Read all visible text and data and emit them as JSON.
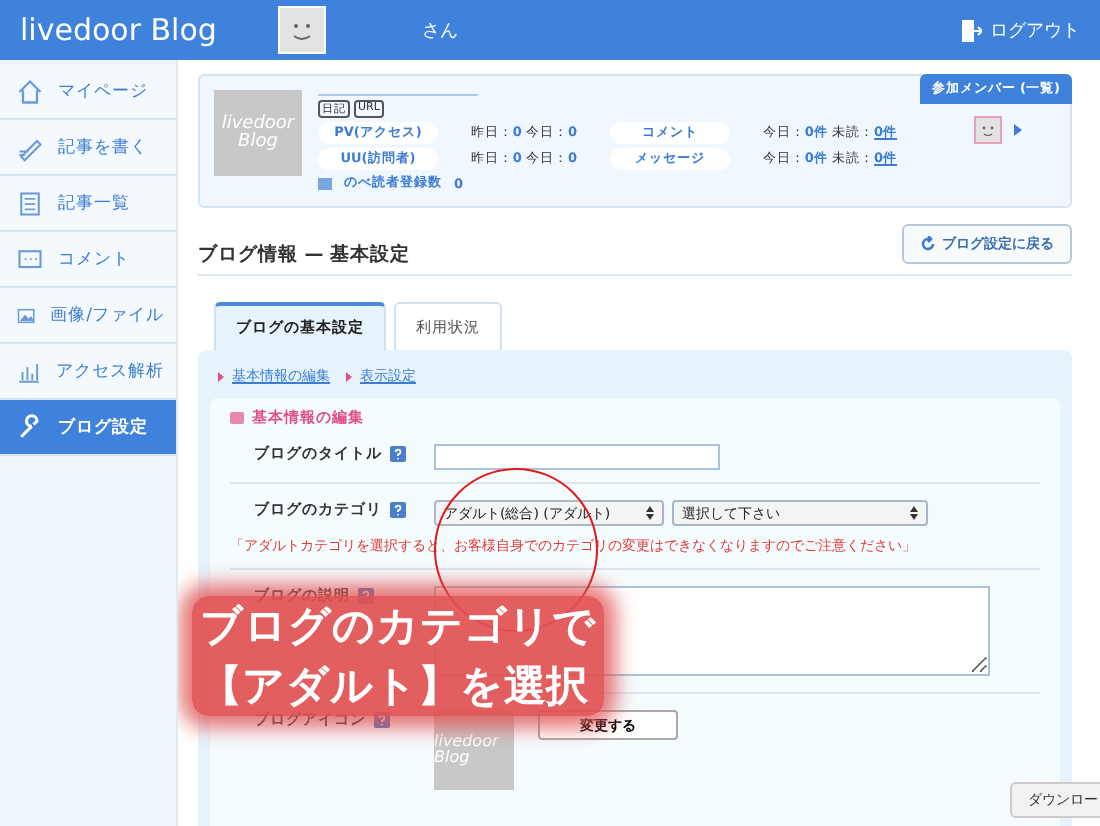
{
  "header": {
    "logo": "livedoor Blog",
    "user_suffix": "さん",
    "logout": "ログアウト"
  },
  "sidebar": {
    "items": [
      {
        "label": "マイページ",
        "selected": false
      },
      {
        "label": "記事を書く",
        "selected": false
      },
      {
        "label": "記事一覧",
        "selected": false
      },
      {
        "label": "コメント",
        "selected": false
      },
      {
        "label": "画像/ファイル",
        "selected": false
      },
      {
        "label": "アクセス解析",
        "selected": false
      },
      {
        "label": "ブログ設定",
        "selected": true
      }
    ]
  },
  "profile": {
    "blog_image": "livedoor Blog",
    "tags": [
      "日記",
      "URL"
    ],
    "stats": [
      {
        "label": "PV(アクセス)",
        "items": [
          {
            "key": "昨日：",
            "value": "0",
            "link": false
          },
          {
            "key": "今日：",
            "value": "0",
            "link": false
          }
        ]
      },
      {
        "label": "コメント",
        "items": [
          {
            "key": "今日：",
            "value": "0件",
            "link": false
          },
          {
            "key": "未読：",
            "value": "0件",
            "link": true
          }
        ]
      },
      {
        "label": "UU(訪問者)",
        "items": [
          {
            "key": "昨日：",
            "value": "0",
            "link": false
          },
          {
            "key": "今日：",
            "value": "0",
            "link": false
          }
        ]
      },
      {
        "label": "メッセージ",
        "items": [
          {
            "key": "今日：",
            "value": "0件",
            "link": false
          },
          {
            "key": "未読：",
            "value": "0件",
            "link": true
          }
        ]
      }
    ],
    "readers": {
      "label": "のべ読者登録数",
      "value": "0"
    },
    "member_button": "参加メンバー (一覧)"
  },
  "page_title": "ブログ情報 — 基本設定",
  "back_button": "ブログ設定に戻る",
  "tabs": [
    {
      "label": "ブログの基本設定",
      "selected": true
    },
    {
      "label": "利用状況",
      "selected": false
    }
  ],
  "sublinks": [
    "基本情報の編集",
    "表示設定"
  ],
  "section_title": "基本情報の編集",
  "fields": [
    {
      "kind": "text",
      "label": "ブログのタイトル"
    },
    {
      "kind": "select",
      "label": "ブログのカテゴリ",
      "selects": [
        "アダルト(総合) (アダルト)",
        "選択して下さい"
      ],
      "warning": "「アダルトカテゴリを選択すると、お客様自身でのカテゴリの変更はできなくなりますのでご注意ください」"
    },
    {
      "kind": "textarea",
      "label": "ブログの説明"
    },
    {
      "kind": "icon",
      "label": "ブログアイコン",
      "image": "livedoor Blog",
      "button": "変更する"
    }
  ],
  "annotation": {
    "lines": [
      "ブログのカテゴリで",
      "【アダルト】を選択"
    ]
  },
  "tooltip": "ダウンロー"
}
